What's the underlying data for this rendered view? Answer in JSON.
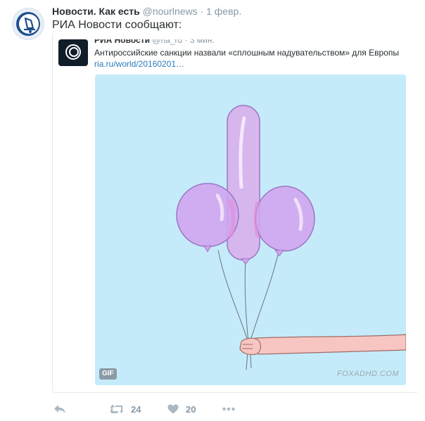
{
  "tweet": {
    "author_name": "Новости. Как есть",
    "handle": "@nourlnews",
    "separator": "·",
    "time": "1 февр.",
    "text": "РИА Новости сообщают:",
    "avatar_icon": "bell-logo-icon"
  },
  "quote": {
    "author_name": "РИА Новости",
    "handle": "@ria_ru",
    "separator": "·",
    "time": "3 мин.",
    "text": "Антироссийские санкции назвали «сплошным надувательством» для Европы",
    "link": "ria.ru/world/20160201…",
    "avatar_icon": "ria-logo-icon"
  },
  "media": {
    "badge": "GIF",
    "watermark": "FOXADHD.COM",
    "background": "#c5ebfa"
  },
  "actions": {
    "reply_icon": "reply-icon",
    "retweet_icon": "retweet-icon",
    "retweet_count": "24",
    "like_icon": "heart-icon",
    "like_count": "20",
    "more_icon": "more-icon"
  }
}
